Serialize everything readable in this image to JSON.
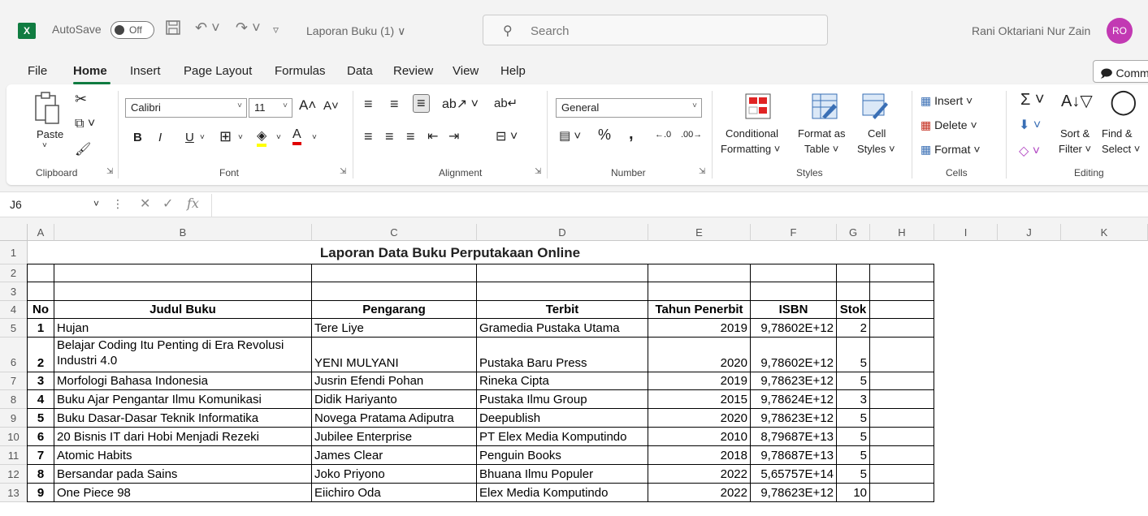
{
  "titlebar": {
    "app_icon": "excel-logo",
    "autosave_label": "AutoSave",
    "autosave_state": "Off",
    "document_name": "Laporan Buku (1) ∨",
    "search_placeholder": "Search",
    "user_name": "Rani Oktariani Nur Zain",
    "user_initials": "RO"
  },
  "menu": {
    "items": [
      "File",
      "Home",
      "Insert",
      "Page Layout",
      "Formulas",
      "Data",
      "Review",
      "View",
      "Help"
    ],
    "active": "Home",
    "comments_label": "Comments"
  },
  "ribbon": {
    "clipboard": {
      "label": "Clipboard",
      "paste": "Paste"
    },
    "font": {
      "label": "Font",
      "family": "Calibri",
      "size": "11",
      "bold": "B",
      "italic": "I",
      "underline": "U"
    },
    "alignment": {
      "label": "Alignment"
    },
    "number": {
      "label": "Number",
      "format": "General"
    },
    "styles": {
      "label": "Styles",
      "conditional_line1": "Conditional",
      "conditional_line2": "Formatting ˅",
      "format_table_line1": "Format as",
      "format_table_line2": "Table ˅",
      "cell_styles_line1": "Cell",
      "cell_styles_line2": "Styles ˅"
    },
    "cells": {
      "label": "Cells",
      "insert": "Insert",
      "delete": "Delete",
      "format": "Format"
    },
    "editing": {
      "label": "Editing",
      "sort_line1": "Sort &",
      "sort_line2": "Filter ˅",
      "find_line1": "Find &",
      "find_line2": "Select ˅"
    }
  },
  "formula_bar": {
    "name_box": "J6",
    "formula": ""
  },
  "sheet": {
    "columns": [
      "A",
      "B",
      "C",
      "D",
      "E",
      "F",
      "G",
      "H",
      "I",
      "J",
      "K"
    ],
    "rows": [
      "1",
      "2",
      "3",
      "4",
      "5",
      "6",
      "7",
      "8",
      "9",
      "10",
      "11",
      "12",
      "13"
    ],
    "title": "Laporan Data Buku Perputakaan Online",
    "headers": [
      "No",
      "Judul Buku",
      "Pengarang",
      "Terbit",
      "Tahun Penerbit",
      "ISBN",
      "Stok"
    ],
    "records": [
      {
        "no": "1",
        "judul": "Hujan",
        "pengarang": "Tere Liye",
        "terbit": "Gramedia Pustaka Utama",
        "tahun": "2019",
        "isbn": "9,78602E+12",
        "stok": "2"
      },
      {
        "no": "2",
        "judul": "Belajar Coding Itu Penting di Era Revolusi Industri 4.0",
        "pengarang": "YENI MULYANI",
        "terbit": "Pustaka Baru Press",
        "tahun": "2020",
        "isbn": "9,78602E+12",
        "stok": "5"
      },
      {
        "no": "3",
        "judul": "Morfologi Bahasa Indonesia",
        "pengarang": "Jusrin Efendi Pohan",
        "terbit": "Rineka Cipta",
        "tahun": "2019",
        "isbn": "9,78623E+12",
        "stok": "5"
      },
      {
        "no": "4",
        "judul": "Buku Ajar Pengantar Ilmu Komunikasi",
        "pengarang": "Didik Hariyanto",
        "terbit": "Pustaka Ilmu Group",
        "tahun": "2015",
        "isbn": "9,78624E+12",
        "stok": "3"
      },
      {
        "no": "5",
        "judul": "Buku Dasar-Dasar Teknik Informatika",
        "pengarang": "Novega Pratama Adiputra",
        "terbit": "Deepublish",
        "tahun": "2020",
        "isbn": "9,78623E+12",
        "stok": "5"
      },
      {
        "no": "6",
        "judul": "20 Bisnis IT dari Hobi Menjadi Rezeki",
        "pengarang": "Jubilee Enterprise",
        "terbit": "PT Elex Media Komputindo",
        "tahun": "2010",
        "isbn": "8,79687E+13",
        "stok": "5"
      },
      {
        "no": "7",
        "judul": "Atomic Habits",
        "pengarang": "James Clear",
        "terbit": "Penguin Books",
        "tahun": "2018",
        "isbn": "9,78687E+13",
        "stok": "5"
      },
      {
        "no": "8",
        "judul": "Bersandar pada Sains",
        "pengarang": "Joko Priyono",
        "terbit": "Bhuana Ilmu Populer",
        "tahun": "2022",
        "isbn": "5,65757E+14",
        "stok": "5"
      },
      {
        "no": "9",
        "judul": "One Piece 98",
        "pengarang": "Eiichiro Oda",
        "terbit": "Elex Media Komputindo",
        "tahun": "2022",
        "isbn": "9,78623E+12",
        "stok": "10"
      }
    ]
  },
  "colors": {
    "accent": "#107c41",
    "avatar": "#c239b3"
  }
}
